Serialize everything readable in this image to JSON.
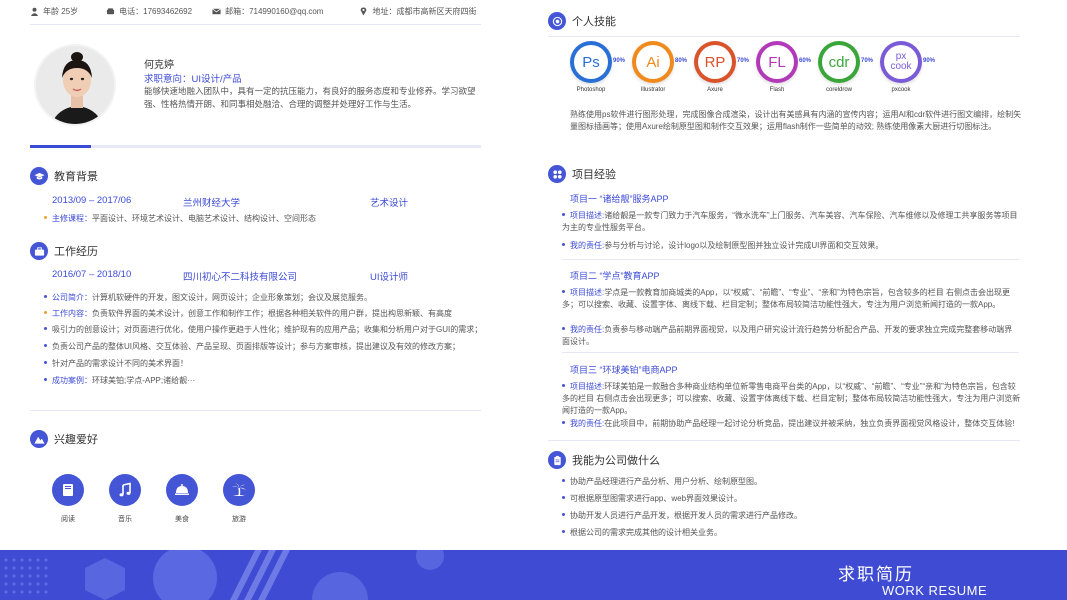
{
  "info": {
    "age": "年龄 25岁",
    "phone": "电话：17693462692",
    "email": "邮箱：714990160@qq.com",
    "address": "地址：成都市高新区天府四街"
  },
  "profile": {
    "name": "何克婷",
    "intent": "求职意向：UI设计/产品",
    "bio": "能够快速地融入团队中，具有一定的抗压能力，有良好的服务态度和专业修养。学习欲望强、性格热情开朗、和同事相处融洽、合理的调整并处理好工作与生活。",
    "progress": 0.135
  },
  "education": {
    "title": "教育背景",
    "period": "2013/09 – 2017/06",
    "school": "兰州财经大学",
    "major": "艺术设计",
    "courses_label": "主修课程：",
    "courses": "平面设计、环境艺术设计、电脑艺术设计、结构设计、空间形态"
  },
  "work": {
    "title": "工作经历",
    "period": "2016/07 – 2018/10",
    "company": "四川初心不二科技有限公司",
    "role": "UI设计师",
    "intro_label": "公司简介：",
    "intro": "计算机软硬件的开发，图文设计，网页设计；企业形象策划；会议及展览服务。",
    "content_label": "工作内容：",
    "content": "负责软件界面的美术设计，创意工作和制作工作；根据各种相关软件的用户群，提出构思新颖、有高度",
    "line3": "吸引力的创意设计；对页面进行优化，使用户操作更趋于人性化；维护现有的应用产品；收集和分析用户对于GUI的需求；",
    "line4": "负责公司产品的整体UI风格、交互体验、产品呈现、页面排版等设计；参与方案审核，提出建议及有效的修改方案；",
    "line5": "针对产品的需求设计不同的美术界面！",
    "cases_label": "成功案例：",
    "cases": "环球美铂;学点-APP;诸给靓···"
  },
  "hobbies": {
    "title": "兴趣爱好",
    "items": [
      "阅读",
      "音乐",
      "美食",
      "旅游"
    ]
  },
  "skills": {
    "title": "个人技能",
    "items": [
      {
        "abbr": "Ps",
        "pct": "90%",
        "name": "Photoshop",
        "color": "#2a6fd6"
      },
      {
        "abbr": "Ai",
        "pct": "80%",
        "name": "Illustrator",
        "color": "#f08a1c"
      },
      {
        "abbr": "RP",
        "pct": "70%",
        "name": "Axure",
        "color": "#d9542a"
      },
      {
        "abbr": "FL",
        "pct": "60%",
        "name": "Flash",
        "color": "#b23ab8"
      },
      {
        "abbr": "cdr",
        "pct": "70%",
        "name": "coreldrow",
        "color": "#3aa63a"
      },
      {
        "abbr": "px cook",
        "pct": "90%",
        "name": "pxcook",
        "color": "#7a5ad6"
      }
    ],
    "desc": "熟练使用ps软件进行图形处理，完成图像合成渲染，设计出有美感具有内涵的宣传内容；运用AI和cdr软件进行图文编排，绘制矢量图标插画等；使用Axure绘制原型图和制作交互效果；运用flash制作一些简单的动效; 熟练使用像素大厨进行切图标注。"
  },
  "projects": {
    "title": "项目经验",
    "items": [
      {
        "name": "项目一  “诸给靓”服务APP",
        "desc_label": "项目描述:",
        "desc": "诸给靓是一款专门致力于汽车服务，“微水洗车”上门服务、汽车美容、汽车保险、汽车维修以及修理工共享服务等项目为主的专业性服务平台。",
        "duty_label": "我的责任:",
        "duty": "参与分析与讨论，设计logo以及绘制原型图并独立设计完成UI界面和交互效果。"
      },
      {
        "name": "项目二  “学点”教育APP",
        "desc_label": "项目描述:",
        "desc": "学点是一款教育加商城类的App，以“权威”、“前瞻”、“专业”、“亲和”为特色宗旨，包含较多的栏目 右侧点击会出现更多；可以搜索、收藏、设置字体、离线下载、栏目定制；整体布局较简洁功能性强大，专注为用户浏览新闻打造的一款App。",
        "duty_label": "我的责任:",
        "duty": "负责参与移动端产品前期界面视觉，以及用户研究设计流行趋势分析配合产品、开发的要求独立完成完整套移动端界面设计。"
      },
      {
        "name": "项目三  “环球美铂”电商APP",
        "desc_label": "项目描述:",
        "desc": "环球美铂是一款融合多种商业结构单位新零售电商平台类的App，以“权威”、“前瞻”、“专业”“亲和”为特色宗旨，包含较多的栏目 右侧点击会出现更多；可以搜索、收藏、设置字体离线下载、栏目定制；整体布局较简洁功能性强大，专注为用户浏览新闻打造的一款App。",
        "duty_label": "我的责任:",
        "duty": "在此项目中，前期协助产品经理一起讨论分析竞品，提出建议并被采纳，独立负责界面视觉风格设计，整体交互体验!"
      }
    ]
  },
  "contribute": {
    "title": "我能为公司做什么",
    "items": [
      "协助产品经理进行产品分析、用户分析、绘制原型图。",
      "可根据原型图需求进行app、web界面效果设计。",
      "协助开发人员进行产品开发，根据开发人员的需求进行产品修改。",
      "根据公司的需求完成其他的设计相关业务。"
    ]
  },
  "footer": {
    "title": "求职简历",
    "subtitle": "WORK RESUME"
  },
  "colors": {
    "accent": "#3c4bd6",
    "footer": "#3f4bd3"
  }
}
